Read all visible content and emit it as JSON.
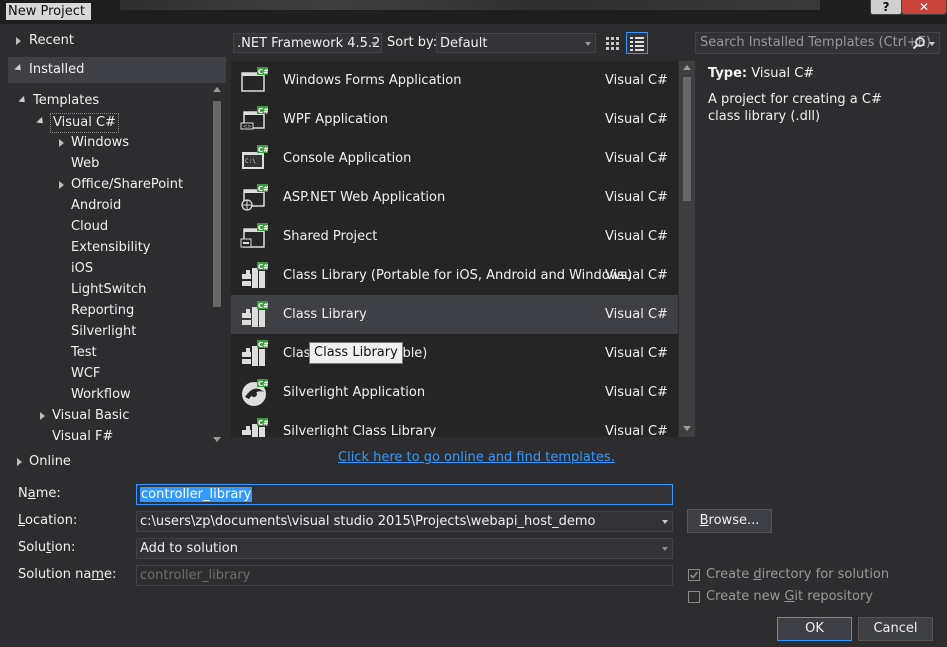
{
  "window": {
    "title": "New Project",
    "help_label": "?",
    "close_label": "✕"
  },
  "left_tree": {
    "recent": "Recent",
    "installed": "Installed",
    "templates": "Templates",
    "visual_csharp": "Visual C#",
    "children": [
      "Windows",
      "Web",
      "Office/SharePoint",
      "Android",
      "Cloud",
      "Extensibility",
      "iOS",
      "LightSwitch",
      "Reporting",
      "Silverlight",
      "Test",
      "WCF",
      "Workflow"
    ],
    "visual_basic": "Visual Basic",
    "visual_fsharp": "Visual F#",
    "online": "Online"
  },
  "toolbar": {
    "framework": ".NET Framework 4.5.2",
    "sort_label": "Sort by:",
    "sort_value": "Default",
    "search_placeholder": "Search Installed Templates (Ctrl+E)"
  },
  "templates": [
    {
      "name": "Windows Forms Application",
      "lang": "Visual C#",
      "icon": "windows-forms-icon"
    },
    {
      "name": "WPF Application",
      "lang": "Visual C#",
      "icon": "wpf-icon"
    },
    {
      "name": "Console Application",
      "lang": "Visual C#",
      "icon": "console-icon"
    },
    {
      "name": "ASP.NET Web Application",
      "lang": "Visual C#",
      "icon": "web-app-icon"
    },
    {
      "name": "Shared Project",
      "lang": "Visual C#",
      "icon": "shared-project-icon"
    },
    {
      "name": "Class Library (Portable for iOS, Android and Windows)",
      "lang": "Visual C#",
      "icon": "class-library-icon"
    },
    {
      "name": "Class Library",
      "lang": "Visual C#",
      "icon": "class-library-icon"
    },
    {
      "name": "Clas",
      "name_tail": "ble)",
      "lang": "Visual C#",
      "icon": "class-library-icon"
    },
    {
      "name": "Silverlight Application",
      "lang": "Visual C#",
      "icon": "silverlight-icon"
    },
    {
      "name": "Silverlight Class Library",
      "lang": "Visual C#",
      "icon": "class-library-icon"
    }
  ],
  "tooltip": "Class Library",
  "info": {
    "type_label": "Type:",
    "type_value": "Visual C#",
    "description": "A project for creating a C# class library (.dll)"
  },
  "online_link": "Click here to go online and find templates.",
  "form": {
    "name_label": "Name:",
    "name_value": "controller_library",
    "location_label": "Location:",
    "location_value": "c:\\users\\zp\\documents\\visual studio 2015\\Projects\\webapi_host_demo",
    "solution_label": "Solution:",
    "solution_value": "Add to solution",
    "solution_name_label": "Solution name:",
    "solution_name_value": "controller_library",
    "browse_label": "Browse...",
    "create_dir_label": "Create directory for solution",
    "git_label": "Create new Git repository",
    "ok_label": "OK",
    "cancel_label": "Cancel"
  },
  "colors": {
    "accent": "#3399ff",
    "selection": "#3f3f46",
    "background": "#2d2d30",
    "link": "#3399ff"
  }
}
